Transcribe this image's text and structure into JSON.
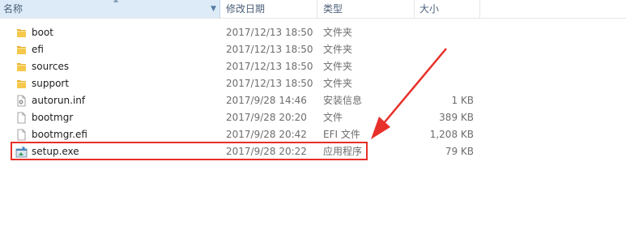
{
  "columns": {
    "name": "名称",
    "date": "修改日期",
    "type": "类型",
    "size": "大小"
  },
  "files": [
    {
      "name": "boot",
      "date": "2017/12/13 18:50",
      "type": "文件夹",
      "size": "",
      "icon": "folder-icon"
    },
    {
      "name": "efi",
      "date": "2017/12/13 18:50",
      "type": "文件夹",
      "size": "",
      "icon": "folder-icon"
    },
    {
      "name": "sources",
      "date": "2017/12/13 18:50",
      "type": "文件夹",
      "size": "",
      "icon": "folder-icon"
    },
    {
      "name": "support",
      "date": "2017/12/13 18:50",
      "type": "文件夹",
      "size": "",
      "icon": "folder-icon"
    },
    {
      "name": "autorun.inf",
      "date": "2017/9/28 14:46",
      "type": "安装信息",
      "size": "1 KB",
      "icon": "setup-info-icon"
    },
    {
      "name": "bootmgr",
      "date": "2017/9/28 20:20",
      "type": "文件",
      "size": "389 KB",
      "icon": "file-icon"
    },
    {
      "name": "bootmgr.efi",
      "date": "2017/9/28 20:42",
      "type": "EFI 文件",
      "size": "1,208 KB",
      "icon": "file-icon"
    },
    {
      "name": "setup.exe",
      "date": "2017/9/28 20:22",
      "type": "应用程序",
      "size": "79 KB",
      "icon": "setup-exe-icon"
    }
  ],
  "colors": {
    "header_selected_bg": "#dcebf7",
    "annotation_red": "#e8302a",
    "folder_yellow": "#f5c84c"
  }
}
